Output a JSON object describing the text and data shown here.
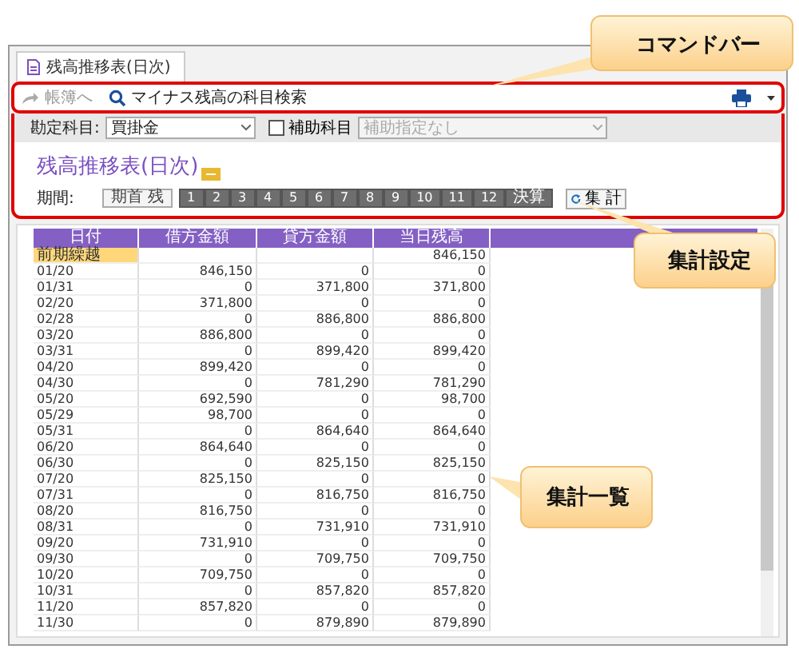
{
  "tab": {
    "label": "残高推移表(日次)",
    "selected": true
  },
  "command_bar": {
    "items": [
      {
        "label": "帳簿へ",
        "disabled": true,
        "kind": "jump"
      },
      {
        "label": "マイナス残高の科目検索",
        "disabled": false,
        "kind": "search"
      }
    ]
  },
  "filters": {
    "account_label": "勘定科目:",
    "account_value": "買掛金",
    "sub_account": {
      "label": "補助科目",
      "checked": false
    },
    "sub_account_value": {
      "value": "補助指定なし",
      "disabled": true
    }
  },
  "title": "残高推移表(日次)",
  "period": {
    "label": "期間:",
    "buttons": [
      {
        "label": "期首 残",
        "selected": false
      },
      {
        "label": "1",
        "selected": true
      },
      {
        "label": "2",
        "selected": true
      },
      {
        "label": "3",
        "selected": true
      },
      {
        "label": "4",
        "selected": true
      },
      {
        "label": "5",
        "selected": true
      },
      {
        "label": "6",
        "selected": true
      },
      {
        "label": "7",
        "selected": true
      },
      {
        "label": "8",
        "selected": true
      },
      {
        "label": "9",
        "selected": true
      },
      {
        "label": "10",
        "selected": true
      },
      {
        "label": "11",
        "selected": true
      },
      {
        "label": "12",
        "selected": true
      },
      {
        "label": "決算",
        "selected": true
      }
    ]
  },
  "aggregate_button": "集 計",
  "table": {
    "columns": [
      "日付",
      "借方金額",
      "貸方金額",
      "当日残高"
    ],
    "rows": [
      {
        "cells": [
          "前期繰越",
          "",
          "",
          "846,150"
        ],
        "selected": true
      },
      {
        "cells": [
          "01/20",
          "846,150",
          "0",
          "0"
        ],
        "selected": false
      },
      {
        "cells": [
          "01/31",
          "0",
          "371,800",
          "371,800"
        ],
        "selected": false
      },
      {
        "cells": [
          "02/20",
          "371,800",
          "0",
          "0"
        ],
        "selected": false
      },
      {
        "cells": [
          "02/28",
          "0",
          "886,800",
          "886,800"
        ],
        "selected": false
      },
      {
        "cells": [
          "03/20",
          "886,800",
          "0",
          "0"
        ],
        "selected": false
      },
      {
        "cells": [
          "03/31",
          "0",
          "899,420",
          "899,420"
        ],
        "selected": false
      },
      {
        "cells": [
          "04/20",
          "899,420",
          "0",
          "0"
        ],
        "selected": false
      },
      {
        "cells": [
          "04/30",
          "0",
          "781,290",
          "781,290"
        ],
        "selected": false
      },
      {
        "cells": [
          "05/20",
          "692,590",
          "0",
          "98,700"
        ],
        "selected": false
      },
      {
        "cells": [
          "05/29",
          "98,700",
          "0",
          "0"
        ],
        "selected": false
      },
      {
        "cells": [
          "05/31",
          "0",
          "864,640",
          "864,640"
        ],
        "selected": false
      },
      {
        "cells": [
          "06/20",
          "864,640",
          "0",
          "0"
        ],
        "selected": false
      },
      {
        "cells": [
          "06/30",
          "0",
          "825,150",
          "825,150"
        ],
        "selected": false
      },
      {
        "cells": [
          "07/20",
          "825,150",
          "0",
          "0"
        ],
        "selected": false
      },
      {
        "cells": [
          "07/31",
          "0",
          "816,750",
          "816,750"
        ],
        "selected": false
      },
      {
        "cells": [
          "08/20",
          "816,750",
          "0",
          "0"
        ],
        "selected": false
      },
      {
        "cells": [
          "08/31",
          "0",
          "731,910",
          "731,910"
        ],
        "selected": false
      },
      {
        "cells": [
          "09/20",
          "731,910",
          "0",
          "0"
        ],
        "selected": false
      },
      {
        "cells": [
          "09/30",
          "0",
          "709,750",
          "709,750"
        ],
        "selected": false
      },
      {
        "cells": [
          "10/20",
          "709,750",
          "0",
          "0"
        ],
        "selected": false
      },
      {
        "cells": [
          "10/31",
          "0",
          "857,820",
          "857,820"
        ],
        "selected": false
      },
      {
        "cells": [
          "11/20",
          "857,820",
          "0",
          "0"
        ],
        "selected": false
      },
      {
        "cells": [
          "11/30",
          "0",
          "879,890",
          "879,890"
        ],
        "selected": false
      }
    ]
  },
  "callouts": [
    {
      "label": "コマンドバー"
    },
    {
      "label": "集計設定"
    },
    {
      "label": "集計一覧"
    }
  ]
}
